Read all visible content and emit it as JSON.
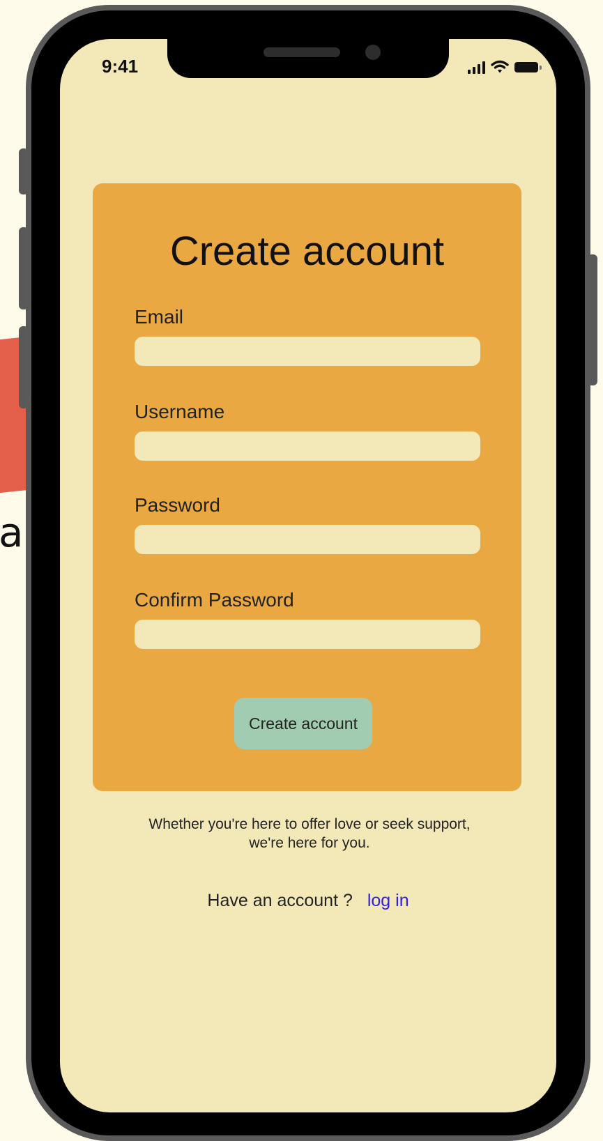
{
  "status_bar": {
    "time": "9:41"
  },
  "form": {
    "title": "Create account",
    "fields": [
      {
        "label": "Email",
        "value": "",
        "placeholder": ""
      },
      {
        "label": "Username",
        "value": "",
        "placeholder": ""
      },
      {
        "label": "Password",
        "value": "",
        "placeholder": ""
      },
      {
        "label": "Confirm Password",
        "value": "",
        "placeholder": ""
      }
    ],
    "submit_label": "Create account"
  },
  "tagline": "Whether you're here to offer love or seek support, we're here for you.",
  "login_prompt": {
    "text": "Have an account ?",
    "link_label": "log in"
  },
  "background": {
    "partial_letter": "a"
  },
  "colors": {
    "page_background": "#fffbea",
    "screen_background": "#f3e9b8",
    "card_background": "#eaa842",
    "input_background": "#f3e9b8",
    "button_background": "#a1ccb1",
    "link_color": "#2f1fe0",
    "accent_shape": "#e35f4a"
  },
  "icons": [
    "signal-icon",
    "wifi-icon",
    "battery-icon"
  ]
}
